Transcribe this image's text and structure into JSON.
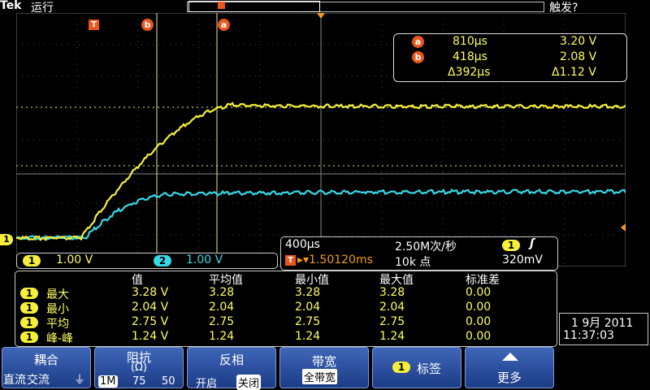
{
  "top": {
    "brand": "Tek",
    "status": "运行",
    "trigger_state": "触发?"
  },
  "markers": {
    "trigger": "T",
    "cursor_b": "b",
    "cursor_a": "a",
    "ch1": "1"
  },
  "cursor_readout": {
    "a_label": "a",
    "a_time": "810µs",
    "a_volt": "3.20 V",
    "b_label": "b",
    "b_time": "418µs",
    "b_volt": "2.08 V",
    "delta_time": "Δ392µs",
    "delta_volt": "Δ1.12 V"
  },
  "channels": {
    "ch1_badge": "1",
    "ch1_scale": "1.00 V",
    "ch2_badge": "2",
    "ch2_scale": "1.00 V"
  },
  "timebase": {
    "time_div": "400µs",
    "sample_rate": "2.50M次/秒",
    "trig_ch": "1",
    "trig_slope": "ʃ",
    "trig_pos_prefix": "T",
    "trig_pos": "▸▾1.50120ms",
    "record_len": "10k 点",
    "trig_level": "320mV"
  },
  "measurements": {
    "headers": [
      "值",
      "平均值",
      "最小值",
      "最大值",
      "标准差"
    ],
    "rows": [
      {
        "ch": "1",
        "name": "最大",
        "value": "3.28 V",
        "mean": "3.28",
        "min": "3.28",
        "max": "3.28",
        "std": "0.00"
      },
      {
        "ch": "1",
        "name": "最小",
        "value": "2.04 V",
        "mean": "2.04",
        "min": "2.04",
        "max": "2.04",
        "std": "0.00"
      },
      {
        "ch": "1",
        "name": "平均",
        "value": "2.75 V",
        "mean": "2.75",
        "min": "2.75",
        "max": "2.75",
        "std": "0.00"
      },
      {
        "ch": "1",
        "name": "峰-峰",
        "value": "1.24 V",
        "mean": "1.24",
        "min": "1.24",
        "max": "1.24",
        "std": "0.00"
      }
    ]
  },
  "datetime": {
    "date": "1 9月 2011",
    "time": "11:37:03"
  },
  "menu": {
    "coupling": {
      "title": "耦合",
      "opt1": "直流",
      "opt2": "交流",
      "opt3": "⏚"
    },
    "impedance": {
      "title": "阻抗",
      "sub": "(Ω)",
      "opt1": "1M",
      "opt2": "75",
      "opt3": "50"
    },
    "invert": {
      "title": "反相",
      "opt1": "开启",
      "opt2": "关闭"
    },
    "bandwidth": {
      "title": "带宽",
      "value": "全带宽"
    },
    "label": {
      "badge": "1",
      "title": "标签"
    },
    "more": {
      "title": "更多"
    }
  },
  "colors": {
    "ch1": "#f5ef3a",
    "ch2": "#38d8e8",
    "marker": "#e8581d",
    "menu": "#2a4c9a"
  }
}
